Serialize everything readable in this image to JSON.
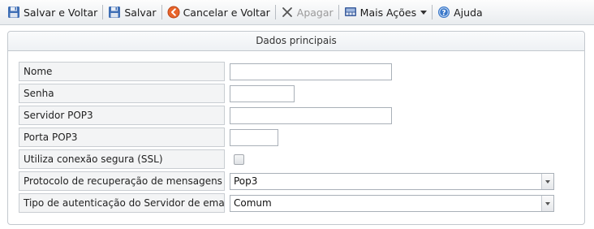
{
  "toolbar": {
    "save_back": "Salvar e Voltar",
    "save": "Salvar",
    "cancel_back": "Cancelar e Voltar",
    "delete": "Apagar",
    "more_actions": "Mais Ações",
    "help": "Ajuda"
  },
  "panel": {
    "title": "Dados principais"
  },
  "form": {
    "name_label": "Nome",
    "name_value": "",
    "password_label": "Senha",
    "password_value": "",
    "pop3_server_label": "Servidor POP3",
    "pop3_server_value": "",
    "pop3_port_label": "Porta POP3",
    "pop3_port_value": "",
    "ssl_label": "Utiliza conexão segura (SSL)",
    "ssl_checked": false,
    "protocol_label": "Protocolo de recuperação de mensagens",
    "protocol_value": "Pop3",
    "auth_label": "Tipo de autenticação do Servidor de email",
    "auth_value": "Comum"
  },
  "colors": {
    "label_bg": "#f3f4f5",
    "border": "#c9cdd2"
  }
}
